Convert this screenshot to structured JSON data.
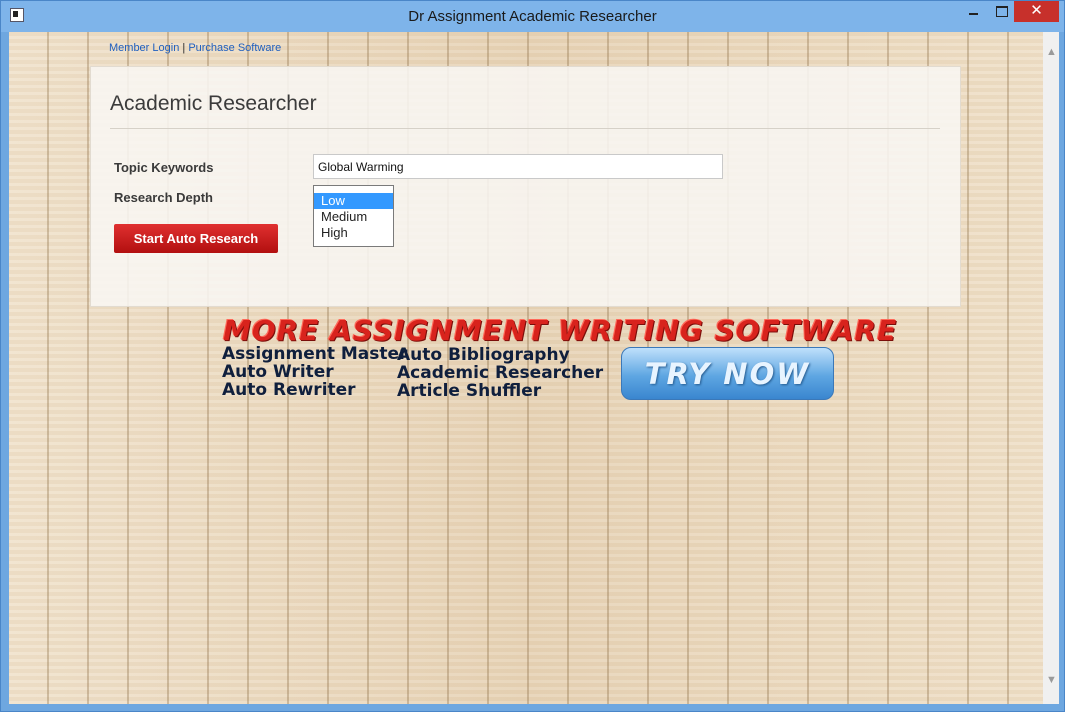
{
  "window": {
    "title": "Dr Assignment Academic Researcher",
    "close_label": "✕"
  },
  "links": {
    "member_login": "Member Login",
    "separator": "|",
    "purchase": "Purchase Software"
  },
  "panel": {
    "title": "Academic Researcher",
    "topic_label": "Topic Keywords",
    "topic_value": "Global Warming",
    "depth_label": "Research Depth",
    "depth_options": [
      "Low",
      "Medium",
      "High"
    ],
    "depth_selected": "Low",
    "start_button": "Start Auto Research"
  },
  "promo": {
    "heading": "MORE ASSIGNMENT WRITING SOFTWARE",
    "column1": [
      "Assignment Master",
      "Auto Writer",
      "Auto Rewriter"
    ],
    "column2": [
      "Auto Bibliography",
      "Academic Researcher",
      "Article Shuffler"
    ],
    "try_button": "TRY NOW"
  },
  "colors": {
    "accent_red": "#c41515",
    "link_blue": "#1f5fbf",
    "selection_blue": "#3399ff"
  }
}
